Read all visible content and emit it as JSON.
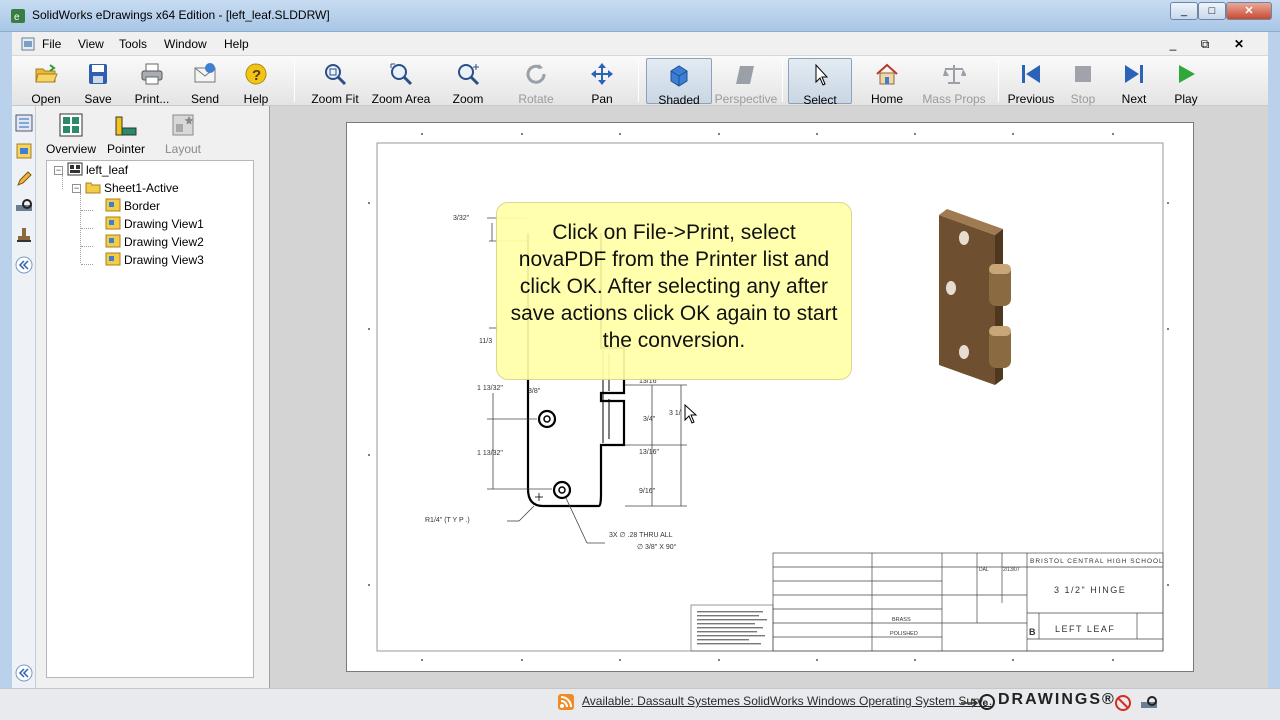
{
  "window": {
    "title": "SolidWorks eDrawings x64 Edition - [left_leaf.SLDDRW]",
    "controls": [
      "_",
      "□",
      "✕"
    ]
  },
  "menu": {
    "items": [
      "File",
      "View",
      "Tools",
      "Window",
      "Help"
    ],
    "mdi_controls": [
      "_",
      "⧉",
      "✕"
    ]
  },
  "toolbar": {
    "open": "Open",
    "save": "Save",
    "print": "Print...",
    "send": "Send",
    "help": "Help",
    "zoom_fit": "Zoom Fit",
    "zoom_area": "Zoom Area",
    "zoom": "Zoom",
    "rotate": "Rotate",
    "pan": "Pan",
    "shaded": "Shaded",
    "perspective": "Perspective",
    "select": "Select",
    "home": "Home",
    "mass_props": "Mass Props",
    "previous": "Previous",
    "stop": "Stop",
    "next": "Next",
    "play": "Play"
  },
  "panel": {
    "tabs": {
      "overview": "Overview",
      "pointer": "Pointer",
      "layout": "Layout"
    },
    "tree": {
      "root": "left_leaf",
      "sheet": "Sheet1-Active",
      "children": [
        "Border",
        "Drawing View1",
        "Drawing View2",
        "Drawing View3"
      ]
    }
  },
  "drawing": {
    "dims": {
      "d_332": "3/32\"",
      "d_1132a": "11/3",
      "d_11332a": "1 13/32\"",
      "d_38": "3/8\"",
      "d_11332b": "1 13/32\"",
      "d_1316a": "13/16\"",
      "d_34": "3/4\"",
      "d_31": "3 1/",
      "d_1316b": "13/16\"",
      "d_916": "9/16\"",
      "r14": "R1/4\" (T Y P .)",
      "hole1": "3X  ∅ .28 THRU ALL",
      "hole2": "∅ 3/8\" X 90°"
    },
    "title_block": {
      "school": "BRISTOL CENTRAL HIGH SCHOOL",
      "title": "3 1/2\" HINGE",
      "size": "B",
      "part": "LEFT LEAF",
      "material": "BRASS",
      "finish": "POLISHED",
      "drawn": "DAL",
      "date": "2/13/07"
    }
  },
  "callout": {
    "text": "Click on File->Print, select novaPDF from the Printer list and click OK. After selecting any after save actions click OK again to start the conversion."
  },
  "status": {
    "link": "Available: Dassault Systemes SolidWorks Windows Operating System Surv...",
    "brand": "DRAWINGS®"
  },
  "colors": {
    "accent": "#2b63b8",
    "callout_bg": "#ffffa8",
    "hinge": "#7a5a3a"
  }
}
